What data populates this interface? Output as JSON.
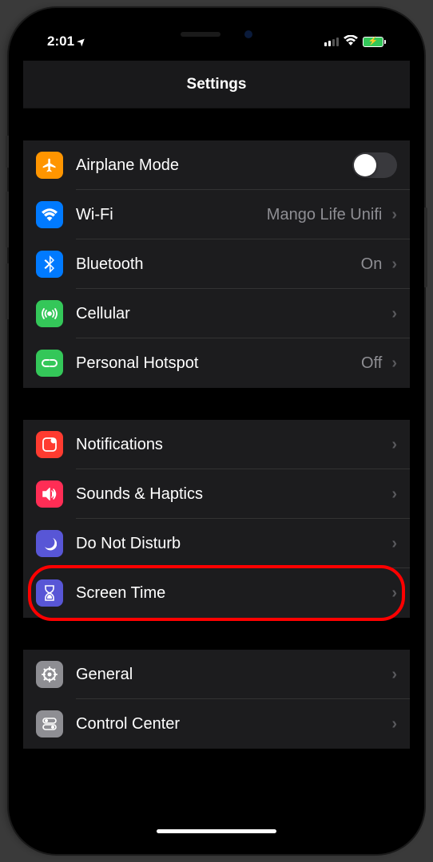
{
  "status": {
    "time": "2:01",
    "location_arrow": "➤"
  },
  "nav": {
    "title": "Settings"
  },
  "rows": {
    "airplane": {
      "label": "Airplane Mode",
      "icon_bg": "#ff9500"
    },
    "wifi": {
      "label": "Wi-Fi",
      "value": "Mango Life Unifi",
      "icon_bg": "#007aff"
    },
    "bluetooth": {
      "label": "Bluetooth",
      "value": "On",
      "icon_bg": "#007aff"
    },
    "cellular": {
      "label": "Cellular",
      "icon_bg": "#34c759"
    },
    "hotspot": {
      "label": "Personal Hotspot",
      "value": "Off",
      "icon_bg": "#34c759"
    },
    "notifications": {
      "label": "Notifications",
      "icon_bg": "#ff3b30"
    },
    "sounds": {
      "label": "Sounds & Haptics",
      "icon_bg": "#ff2d55"
    },
    "dnd": {
      "label": "Do Not Disturb",
      "icon_bg": "#5856d6"
    },
    "screentime": {
      "label": "Screen Time",
      "icon_bg": "#5856d6"
    },
    "general": {
      "label": "General",
      "icon_bg": "#8e8e93"
    },
    "controlcenter": {
      "label": "Control Center",
      "icon_bg": "#8e8e93"
    }
  },
  "highlighted": "screentime"
}
